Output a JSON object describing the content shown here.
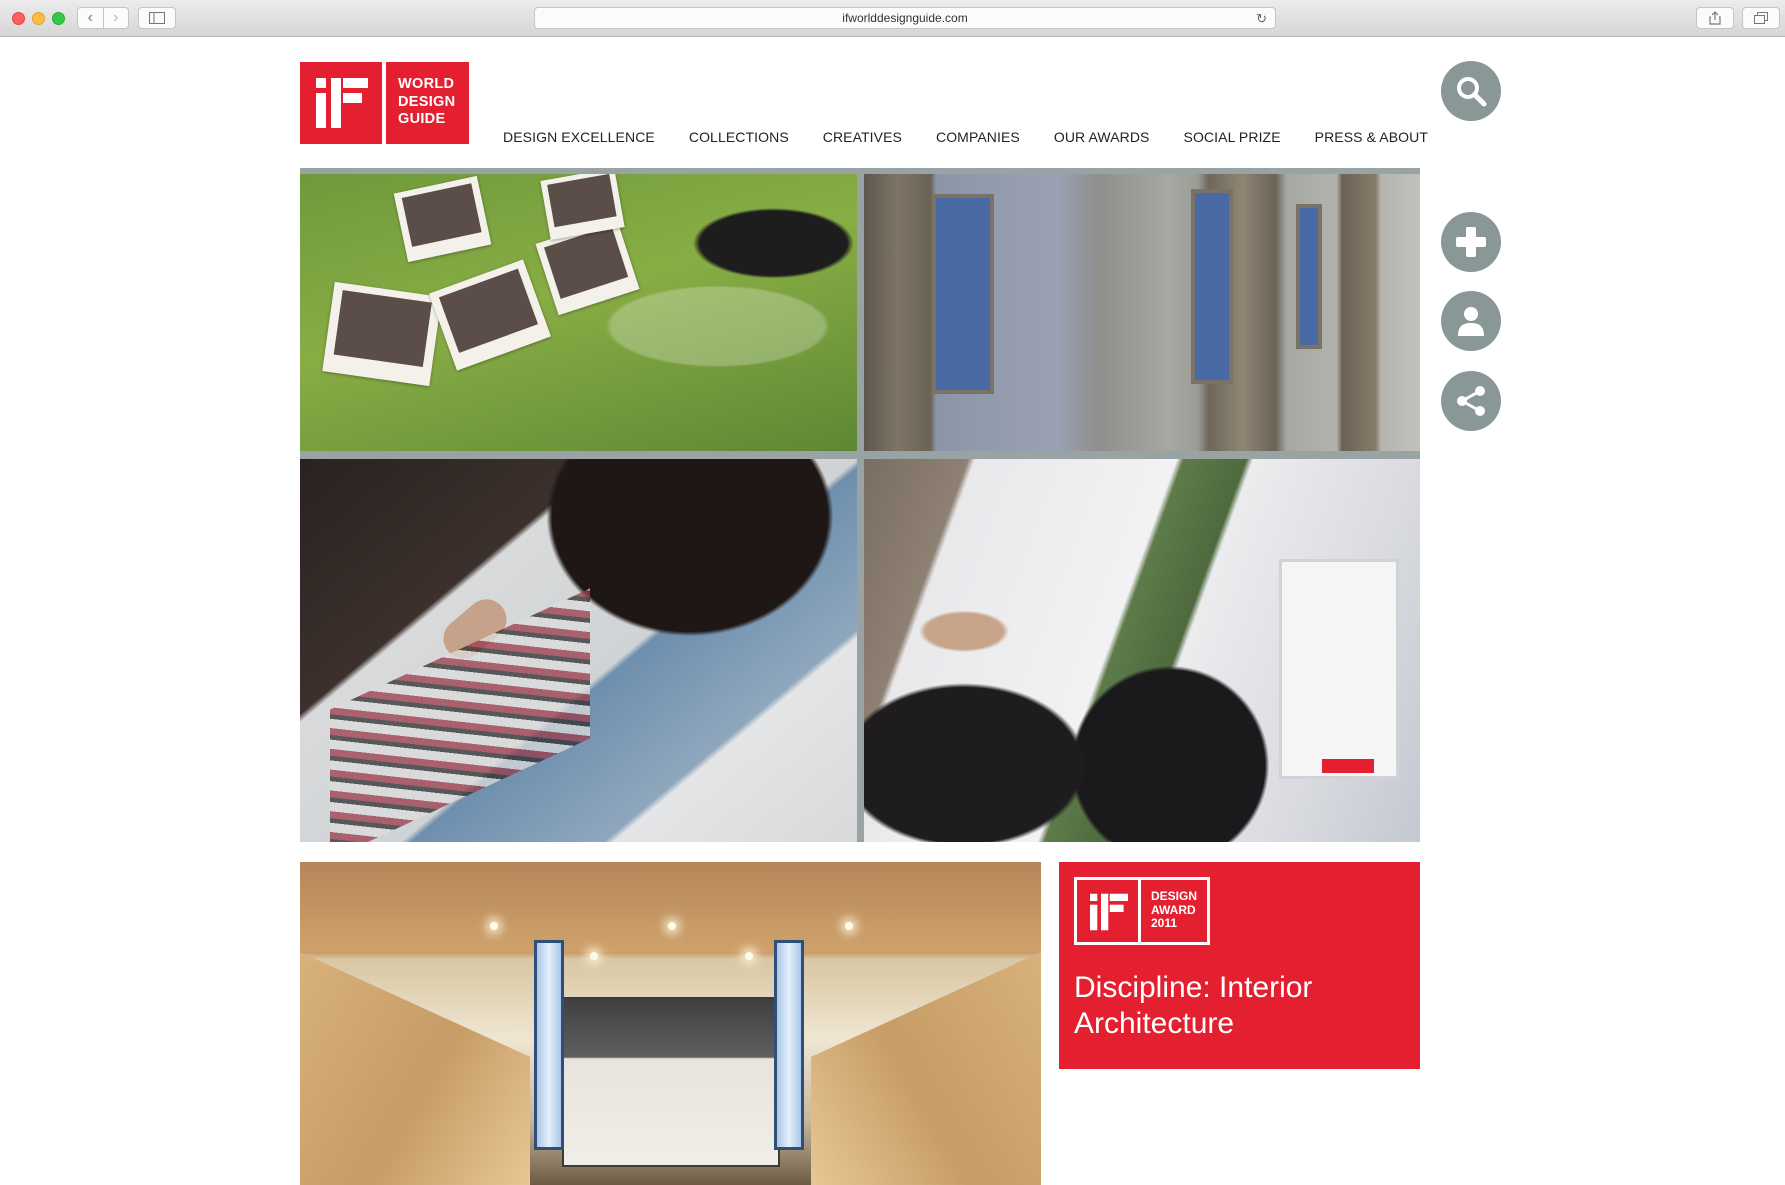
{
  "browser": {
    "url": "ifworlddesignguide.com",
    "back_glyph": "‹",
    "forward_glyph": "›",
    "reload_glyph": "↻"
  },
  "logo": {
    "mark": "iF",
    "line1": "WORLD",
    "line2": "DESIGN",
    "line3": "GUIDE",
    "color": "#e42030"
  },
  "nav": {
    "items": [
      {
        "label": "DESIGN EXCELLENCE"
      },
      {
        "label": "COLLECTIONS"
      },
      {
        "label": "CREATIVES"
      },
      {
        "label": "COMPANIES"
      },
      {
        "label": "OUR AWARDS"
      },
      {
        "label": "SOCIAL PRIZE"
      },
      {
        "label": "PRESS & ABOUT"
      }
    ]
  },
  "side_buttons": {
    "search": "search-icon",
    "add": "plus-icon",
    "account": "user-icon",
    "share": "share-icon",
    "color": "#8a9797"
  },
  "award": {
    "badge_line1": "DESIGN",
    "badge_line2": "AWARD",
    "badge_line3": "2011",
    "discipline": "Discipline: Interior Architecture"
  }
}
